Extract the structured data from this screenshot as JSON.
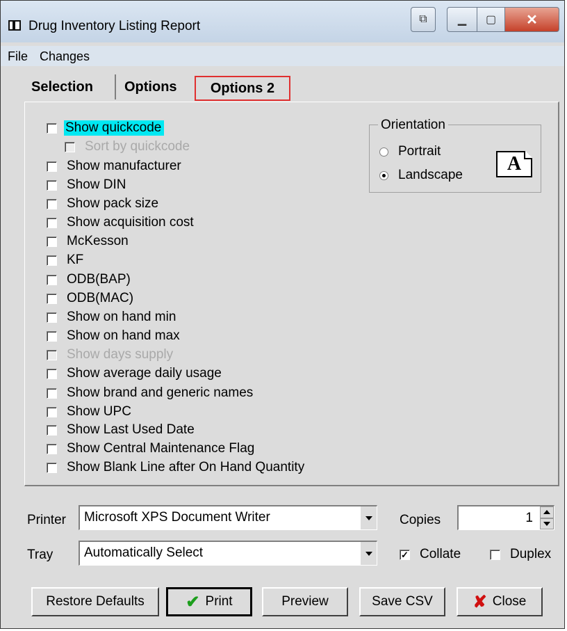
{
  "window": {
    "title": "Drug Inventory Listing Report"
  },
  "menu": [
    "File",
    "Changes"
  ],
  "tabs": [
    "Selection",
    "Options",
    "Options 2"
  ],
  "options": [
    {
      "label": "Show quickcode",
      "checked": false,
      "disabled": false,
      "highlighted": true
    },
    {
      "label": "Sort by quickcode",
      "checked": false,
      "disabled": true,
      "indent": true
    },
    {
      "label": "Show manufacturer",
      "checked": false
    },
    {
      "label": "Show DIN",
      "checked": false
    },
    {
      "label": "Show pack size",
      "checked": false
    },
    {
      "label": "Show acquisition cost",
      "checked": false
    },
    {
      "label": "McKesson",
      "checked": false
    },
    {
      "label": "KF",
      "checked": false
    },
    {
      "label": "ODB(BAP)",
      "checked": false
    },
    {
      "label": "ODB(MAC)",
      "checked": false
    },
    {
      "label": "Show on hand min",
      "checked": false
    },
    {
      "label": "Show on hand max",
      "checked": false
    },
    {
      "label": "Show days supply",
      "checked": false,
      "disabled": true
    },
    {
      "label": "Show average daily usage",
      "checked": false
    },
    {
      "label": "Show brand and generic names",
      "checked": false
    },
    {
      "label": "Show UPC",
      "checked": false
    },
    {
      "label": "Show Last Used Date",
      "checked": false
    },
    {
      "label": "Show Central Maintenance Flag",
      "checked": false
    },
    {
      "label": "Show Blank Line after On Hand Quantity",
      "checked": false
    }
  ],
  "orientation": {
    "title": "Orientation",
    "portrait": "Portrait",
    "landscape": "Landscape",
    "selected": "Landscape",
    "icon_letter": "A"
  },
  "printer": {
    "label": "Printer",
    "value": "Microsoft XPS Document Writer"
  },
  "tray": {
    "label": "Tray",
    "value": "Automatically Select"
  },
  "copies": {
    "label": "Copies",
    "value": "1"
  },
  "collate": {
    "label": "Collate",
    "checked": true
  },
  "duplex": {
    "label": "Duplex",
    "checked": false
  },
  "buttons": {
    "restore": "Restore Defaults",
    "print": "Print",
    "preview": "Preview",
    "save_csv": "Save CSV",
    "close": "Close"
  },
  "colors": {
    "highlight": "#00e8f2",
    "tab_outline": "#e03030",
    "check_green": "#1c9e1c",
    "close_red": "#d01010"
  }
}
